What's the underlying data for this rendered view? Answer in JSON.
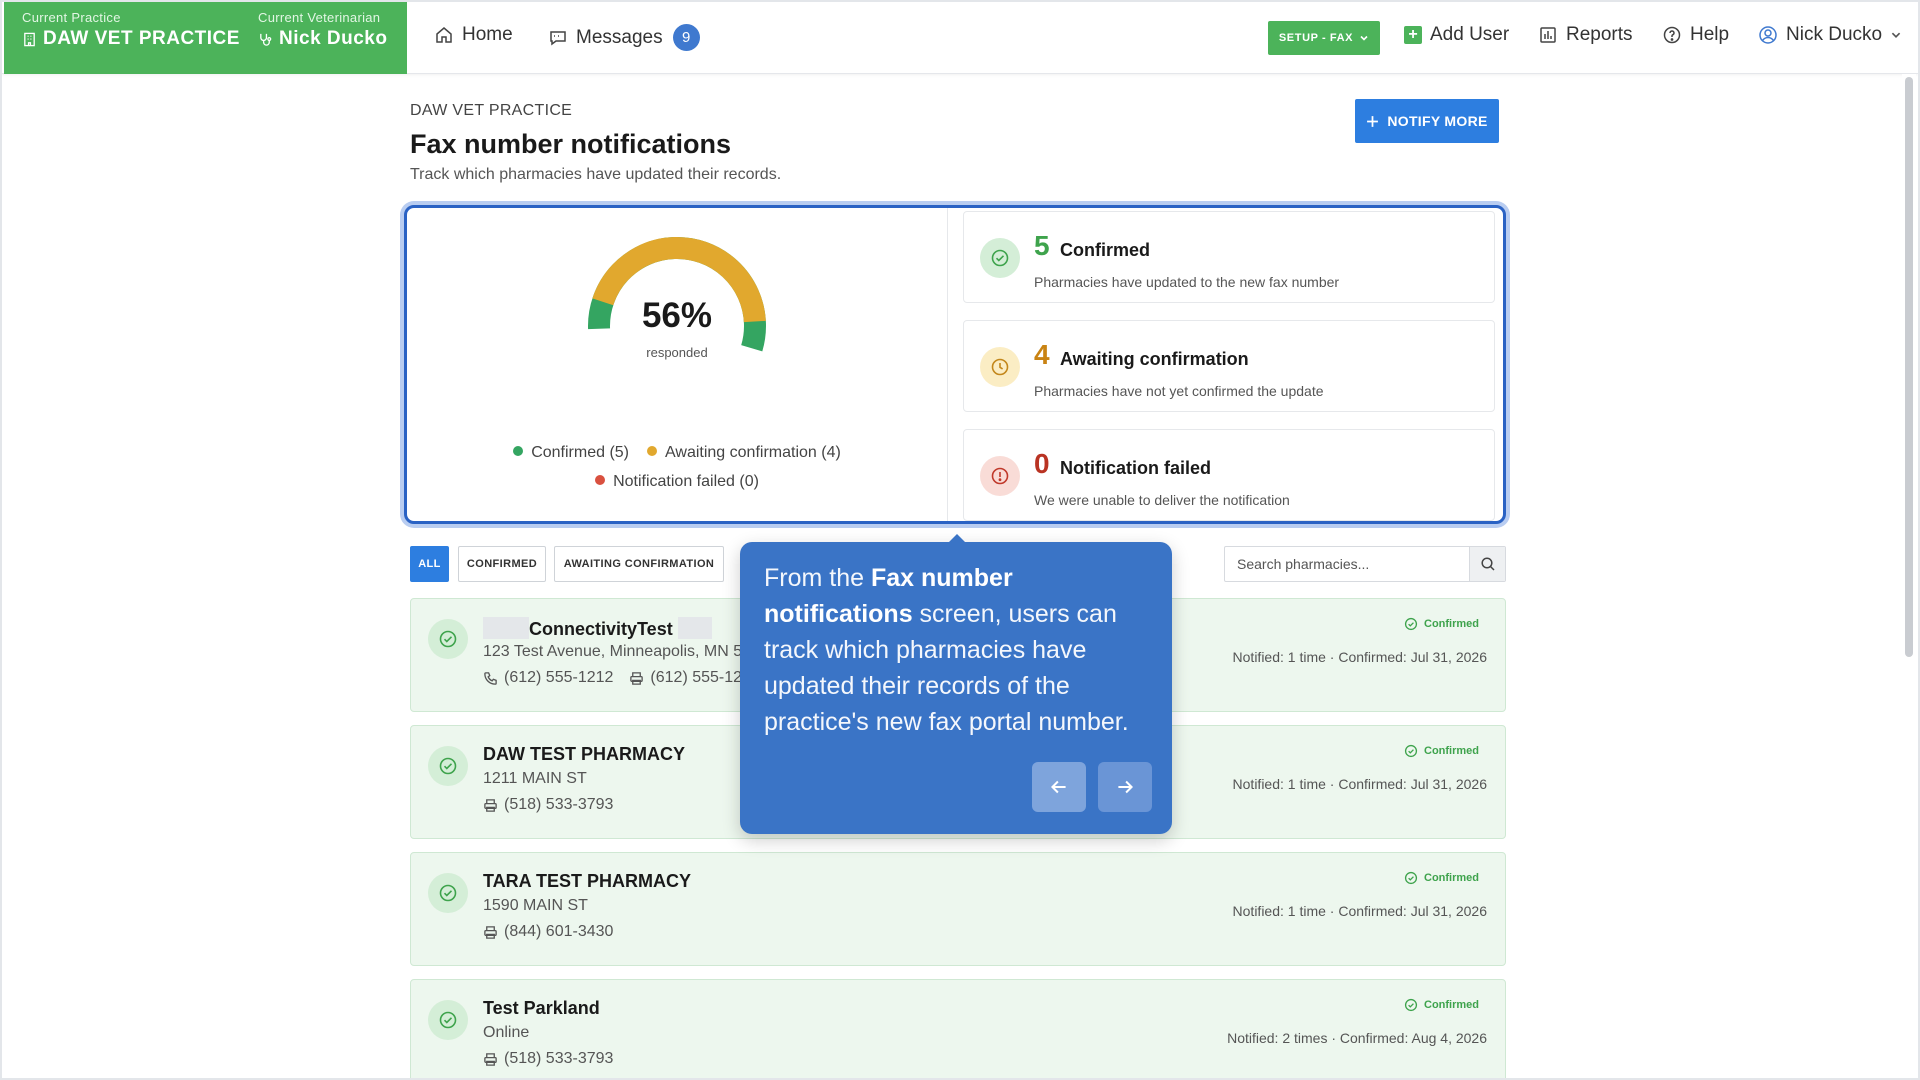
{
  "header": {
    "practice_caption": "Current Practice",
    "practice_name": "DAW VET PRACTICE",
    "vet_caption": "Current Veterinarian",
    "vet_name": "Nick Ducko",
    "nav_home": "Home",
    "nav_messages": "Messages",
    "messages_count": "9",
    "setup_label": "SETUP - FAX",
    "add_user": "Add User",
    "reports": "Reports",
    "help": "Help",
    "user_name": "Nick Ducko"
  },
  "page": {
    "breadcrumb": "DAW VET PRACTICE",
    "title": "Fax number notifications",
    "subtitle": "Track which pharmacies have updated their records.",
    "notify_button": "NOTIFY MORE"
  },
  "summary": {
    "percent": "56%",
    "percent_label": "responded",
    "legend": {
      "confirmed": "Confirmed (5)",
      "awaiting": "Awaiting confirmation (4)",
      "failed": "Notification failed (0)"
    },
    "stats": [
      {
        "count": "5",
        "title": "Confirmed",
        "desc": "Pharmacies have updated to the new fax number"
      },
      {
        "count": "4",
        "title": "Awaiting confirmation",
        "desc": "Pharmacies have not yet confirmed the update"
      },
      {
        "count": "0",
        "title": "Notification failed",
        "desc": "We were unable to deliver the notification"
      }
    ]
  },
  "chart_data": {
    "type": "pie",
    "categories": [
      "Confirmed",
      "Awaiting confirmation",
      "Notification failed"
    ],
    "values": [
      5,
      4,
      0
    ],
    "title": "56%",
    "center_label": "responded",
    "colors": [
      "#34a561",
      "#e1a82e",
      "#d9503f"
    ]
  },
  "filters": {
    "all": "ALL",
    "confirmed": "CONFIRMED",
    "awaiting": "AWAITING CONFIRMATION",
    "search_placeholder": "Search pharmacies..."
  },
  "pharmacies": [
    {
      "name": "ConnectivityTest",
      "address": "123 Test Avenue, Minneapolis, MN 5",
      "phone": "(612) 555-1212",
      "fax": "(612) 555-121",
      "status": "Confirmed",
      "meta": "Notified: 1 time · Confirmed: Jul 31, 2026"
    },
    {
      "name": "DAW TEST PHARMACY",
      "address": "1211 MAIN ST",
      "fax": "(518) 533-3793",
      "status": "Confirmed",
      "meta": "Notified: 1 time · Confirmed: Jul 31, 2026"
    },
    {
      "name": "TARA TEST PHARMACY",
      "address": "1590 MAIN ST",
      "fax": "(844) 601-3430",
      "status": "Confirmed",
      "meta": "Notified: 1 time · Confirmed: Jul 31, 2026"
    },
    {
      "name": "Test Parkland",
      "address": "Online",
      "fax": "(518) 533-3793",
      "status": "Confirmed",
      "meta": "Notified: 2 times · Confirmed: Aug 4, 2026"
    }
  ],
  "tooltip": {
    "pre": "From the ",
    "bold": "Fax number notifications",
    "post": " screen, users can track which pharmacies have updated their records of the practice's new fax portal number."
  },
  "colors": {
    "brand_green": "#4cb35a",
    "primary_blue": "#2d7ee0",
    "confirmed": "#34a561",
    "awaiting": "#e1a82e",
    "failed": "#d9503f",
    "tooltip": "#3a74c6"
  }
}
